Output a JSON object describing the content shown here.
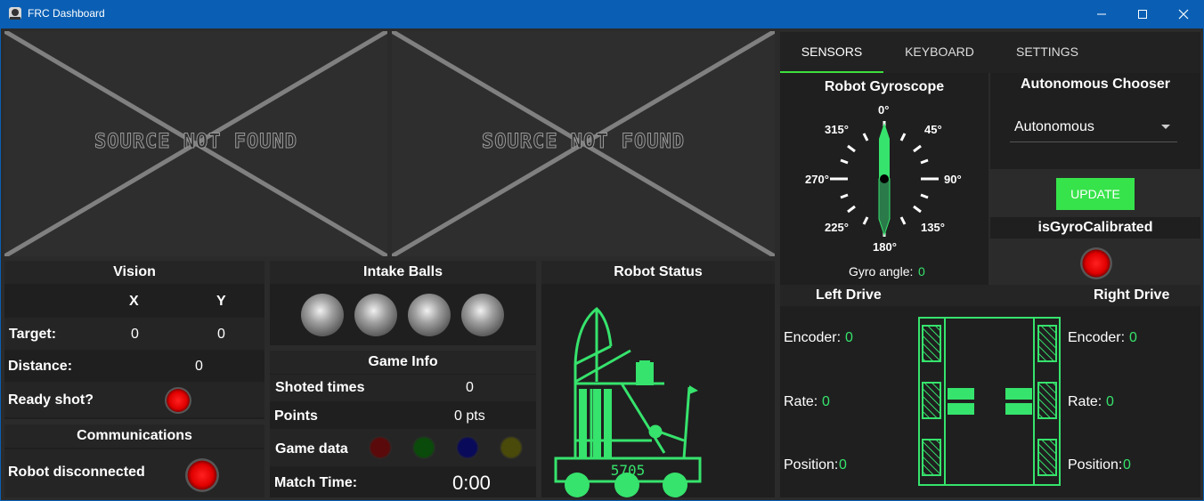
{
  "window": {
    "title": "FRC Dashboard"
  },
  "cameras": [
    {
      "label": "SOURCE NOT FOUND"
    },
    {
      "label": "SOURCE NOT FOUND"
    }
  ],
  "vision": {
    "title": "Vision",
    "col_x": "X",
    "col_y": "Y",
    "target_label": "Target:",
    "target_x": "0",
    "target_y": "0",
    "distance_label": "Distance:",
    "distance_value": "0",
    "ready_label": "Ready shot?"
  },
  "communications": {
    "title": "Communications",
    "status": "Robot disconnected"
  },
  "intake": {
    "title": "Intake Balls",
    "count": 4
  },
  "game_info": {
    "title": "Game Info",
    "shoted_label": "Shoted times",
    "shoted_value": "0",
    "points_label": "Points",
    "points_value": "0 pts",
    "game_data_label": "Game data",
    "game_data_colors": [
      "#5a0a0a",
      "#0a4a0a",
      "#0a0a5a",
      "#4a4a0a"
    ],
    "match_time_label": "Match Time:",
    "match_time_value": "0:00"
  },
  "robot_status": {
    "title": "Robot Status",
    "team_number": "5705"
  },
  "tabs": [
    "SENSORS",
    "KEYBOARD",
    "SETTINGS"
  ],
  "gyro": {
    "title": "Robot Gyroscope",
    "labels": {
      "n": "0°",
      "ne": "45°",
      "e": "90°",
      "se": "135°",
      "s": "180°",
      "sw": "225°",
      "w": "270°",
      "nw": "315°"
    },
    "angle_label": "Gyro angle:",
    "angle_value": "0"
  },
  "auto": {
    "title": "Autonomous Chooser",
    "selected": "Autonomous",
    "update_label": "UPDATE",
    "calibrated_title": "isGyroCalibrated"
  },
  "left_drive": {
    "title": "Left Drive",
    "encoder_label": "Encoder:",
    "encoder_value": "0",
    "rate_label": "Rate:",
    "rate_value": "0",
    "position_label": "Position:",
    "position_value": "0"
  },
  "right_drive": {
    "title": "Right Drive",
    "encoder_label": "Encoder:",
    "encoder_value": "0",
    "rate_label": "Rate:",
    "rate_value": "0",
    "position_label": "Position:",
    "position_value": "0"
  },
  "colors": {
    "accent_green": "#36e36c",
    "titlebar": "#0a5fb4",
    "led_red": "#ff2020"
  }
}
